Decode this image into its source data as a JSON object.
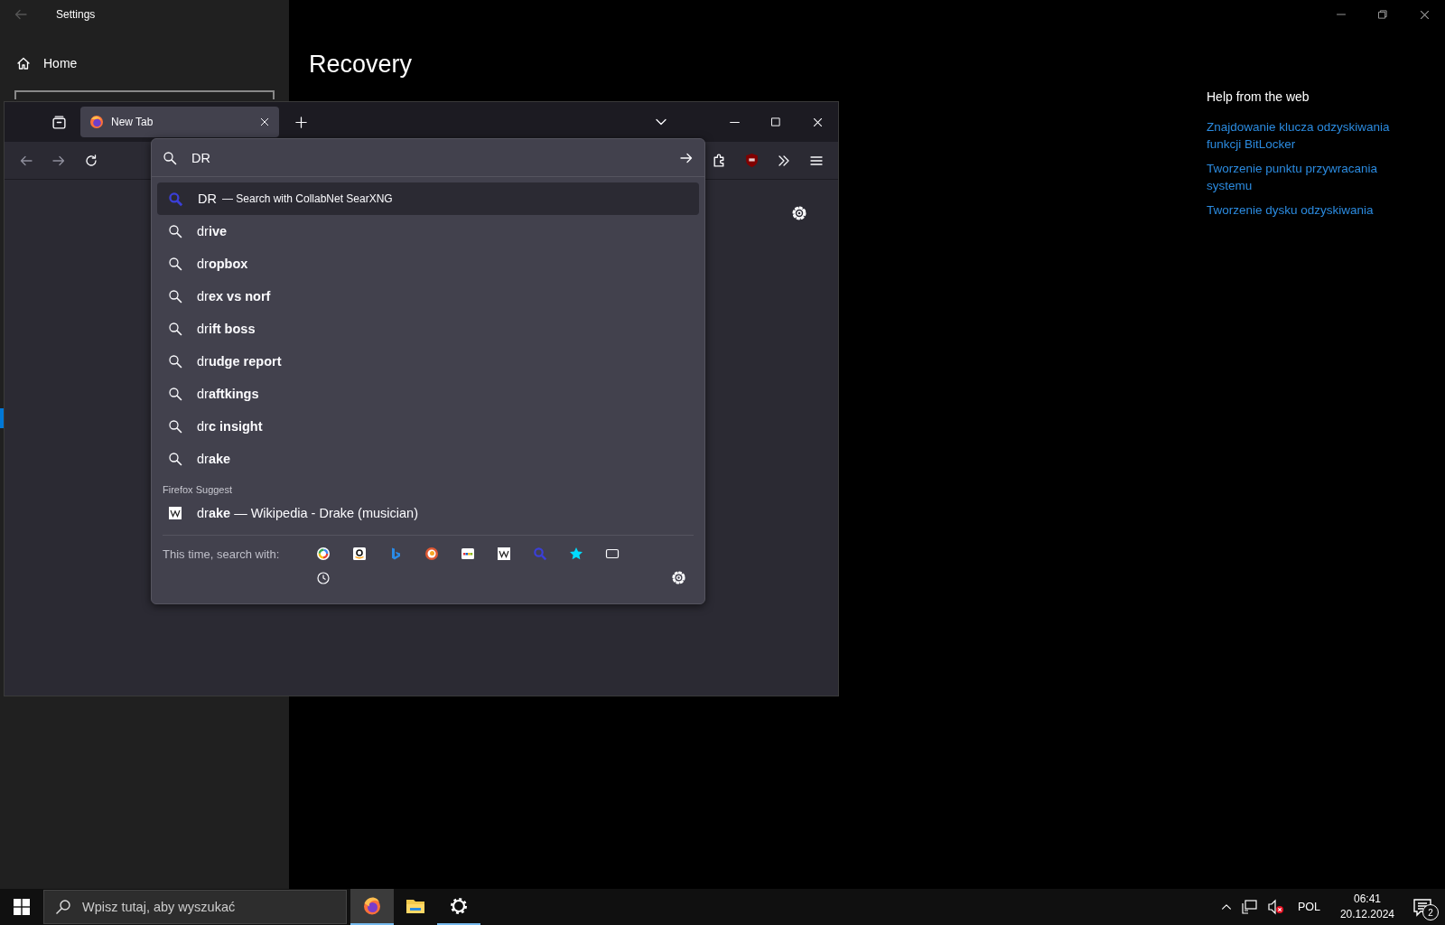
{
  "settings_window": {
    "title": "Settings",
    "nav_items": [
      {
        "label": "Home"
      }
    ],
    "page_title": "Recovery",
    "help": {
      "heading": "Help from the web",
      "links": [
        "Znajdowanie klucza odzyskiwania funkcji BitLocker",
        "Tworzenie punktu przywracania systemu",
        "Tworzenie dysku odzyskiwania"
      ]
    }
  },
  "browser": {
    "tabs": [
      {
        "label": "New Tab",
        "selected": true
      }
    ],
    "urlbar": {
      "value": "DR"
    },
    "suggestions": [
      {
        "kind": "engine",
        "text": "DR",
        "action": "— Search with CollabNet SearXNG",
        "selected": true
      },
      {
        "kind": "search",
        "text": "dr**ive**",
        "selected": false
      },
      {
        "kind": "search",
        "text": "dr**opbox**",
        "selected": false
      },
      {
        "kind": "search",
        "text": "dr**ex vs norf**",
        "selected": false
      },
      {
        "kind": "search",
        "text": "dr**ift boss**",
        "selected": false
      },
      {
        "kind": "search",
        "text": "dr**udge report**",
        "selected": false
      },
      {
        "kind": "search",
        "text": "dr**aftkings**",
        "selected": false
      },
      {
        "kind": "search",
        "text": "dr**c insight**",
        "selected": false
      },
      {
        "kind": "search",
        "text": "dr**ake**",
        "selected": false
      }
    ],
    "suggest_group": {
      "heading": "Firefox Suggest",
      "items": [
        {
          "kind": "wikipedia",
          "text": "dr**ake** — Wikipedia - Drake (musician)",
          "selected": false
        }
      ]
    },
    "one_offs": {
      "label": "This time, search with:",
      "engines": [
        {
          "kind": "google"
        },
        {
          "kind": "amazon"
        },
        {
          "kind": "bing"
        },
        {
          "kind": "duckduckgo"
        },
        {
          "kind": "ebay"
        },
        {
          "kind": "wikipedia"
        },
        {
          "kind": "searxng"
        },
        {
          "kind": "bookmarks"
        },
        {
          "kind": "tabs"
        },
        {
          "kind": "history"
        }
      ]
    }
  },
  "taskbar": {
    "search_placeholder": "Wpisz tutaj, aby wyszukać",
    "apps": [
      {
        "kind": "firefox",
        "active": true,
        "running": true
      },
      {
        "kind": "explorer",
        "active": false,
        "running": false
      },
      {
        "kind": "settings",
        "active": false,
        "running": true
      }
    ],
    "language": "POL",
    "time": "06:41",
    "date": "20.12.2024",
    "notification_count": "2"
  }
}
